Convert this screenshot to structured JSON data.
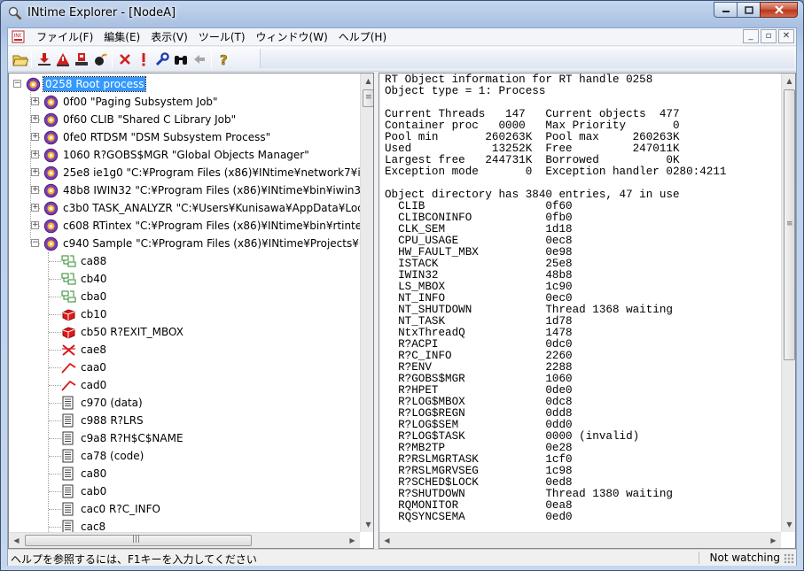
{
  "window": {
    "title": "INtime Explorer - [NodeA]"
  },
  "menu": {
    "items": [
      "ファイル(F)",
      "編集(E)",
      "表示(V)",
      "ツール(T)",
      "ウィンドウ(W)",
      "ヘルプ(H)"
    ]
  },
  "toolbar": {
    "buttons": [
      "open-folder",
      "download",
      "warning-stop",
      "save-red",
      "bomb",
      "delete-x",
      "alert-exclaim",
      "wrench",
      "binoculars",
      "back-arrow",
      "help"
    ]
  },
  "tree": {
    "root": "0258 Root process",
    "processes": [
      "0f00  \"Paging Subsystem Job\"",
      "0f60 CLIB \"Shared C Library Job\"",
      "0fe0 RTDSM \"DSM Subsystem Process\"",
      "1060 R?GOBS$MGR \"Global Objects Manager\"",
      "25e8 ie1g0 \"C:¥Program Files (x86)¥INtime¥network7¥is",
      "48b8 IWIN32 \"C:¥Program Files (x86)¥INtime¥bin¥iwin3",
      "c3b0 TASK_ANALYZR \"C:¥Users¥Kunisawa¥AppData¥Loc",
      "c608 RTintex \"C:¥Program Files (x86)¥INtime¥bin¥rtinte",
      "c940 Sample \"C:¥Program Files (x86)¥INtime¥Projects¥("
    ],
    "children": [
      {
        "label": "ca88",
        "icon": "mailbox-icon"
      },
      {
        "label": "cb40",
        "icon": "mailbox-icon"
      },
      {
        "label": "cba0",
        "icon": "mailbox-icon"
      },
      {
        "label": "cb10",
        "icon": "semaphore-icon"
      },
      {
        "label": "cb50 R?EXIT_MBOX",
        "icon": "semaphore-icon"
      },
      {
        "label": "cae8",
        "icon": "alarm-icon"
      },
      {
        "label": "caa0",
        "icon": "thread-icon"
      },
      {
        "label": "cad0",
        "icon": "thread-icon"
      },
      {
        "label": "c970 (data)",
        "icon": "segment-icon"
      },
      {
        "label": "c988 R?LRS",
        "icon": "segment-icon"
      },
      {
        "label": "c9a8 R?H$C$NAME",
        "icon": "segment-icon"
      },
      {
        "label": "ca78 (code)",
        "icon": "segment-icon"
      },
      {
        "label": "ca80",
        "icon": "segment-icon"
      },
      {
        "label": "cab0",
        "icon": "segment-icon"
      },
      {
        "label": "cac0 R?C_INFO",
        "icon": "segment-icon"
      },
      {
        "label": "cac8",
        "icon": "segment-icon"
      }
    ]
  },
  "info": {
    "lines": [
      "RT Object information for RT handle 0258",
      "Object type = 1: Process",
      "",
      "Current Threads   147   Current objects  477",
      "Container proc   0000   Max Priority       0",
      "Pool min       260263K  Pool max     260263K",
      "Used            13252K  Free         247011K",
      "Largest free   244731K  Borrowed          0K",
      "Exception mode       0  Exception handler 0280:4211",
      "",
      "Object directory has 3840 entries, 47 in use",
      "  CLIB                  0f60",
      "  CLIBCONINFO           0fb0",
      "  CLK_SEM               1d18",
      "  CPU_USAGE             0ec8",
      "  HW_FAULT_MBX          0e98",
      "  ISTACK                25e8",
      "  IWIN32                48b8",
      "  LS_MBOX               1c90",
      "  NT_INFO               0ec0",
      "  NT_SHUTDOWN           Thread 1368 waiting",
      "  NT_TASK               1d78",
      "  NtxThreadQ            1478",
      "  R?ACPI                0dc0",
      "  R?C_INFO              2260",
      "  R?ENV                 2288",
      "  R?GOBS$MGR            1060",
      "  R?HPET                0de0",
      "  R?LOG$MBOX            0dc8",
      "  R?LOG$REGN            0dd8",
      "  R?LOG$SEM             0dd0",
      "  R?LOG$TASK            0000 (invalid)",
      "  R?MB2TP               0e28",
      "  R?RSLMGRTASK          1cf0",
      "  R?RSLMGRVSEG          1c98",
      "  R?SCHED$LOCK          0ed8",
      "  R?SHUTDOWN            Thread 1380 waiting",
      "  RQMONITOR             0ea8",
      "  RQSYNCSEMA            0ed0"
    ]
  },
  "status": {
    "help_text": "ヘルプを参照するには、F1キーを入力してください",
    "watch_state": "Not watching"
  },
  "colors": {
    "selection": "#3399ff",
    "process_icon": "#7b3fb4",
    "accent_red": "#d22020"
  }
}
